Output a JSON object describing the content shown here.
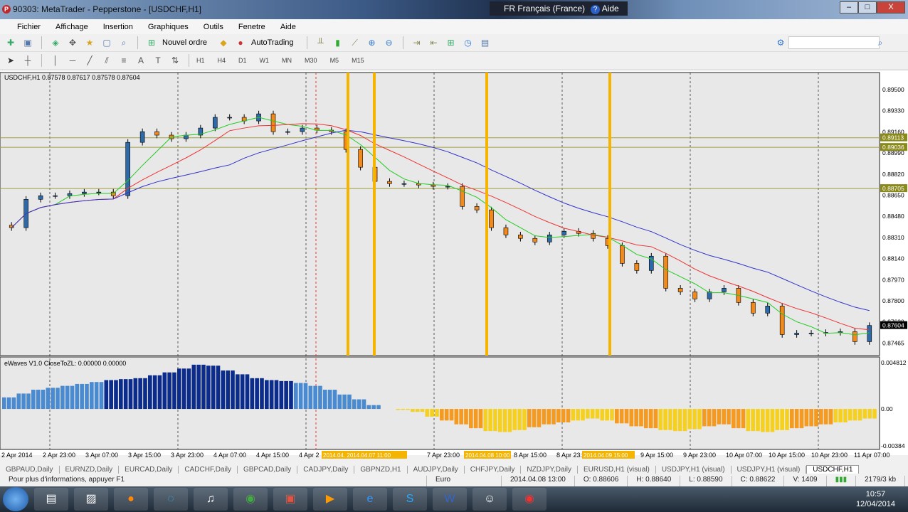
{
  "window": {
    "title": "90303: MetaTrader - Pepperstone - [USDCHF,H1]",
    "lang": "FR Français (France)",
    "help": "Aide"
  },
  "menu": [
    "Fichier",
    "Affichage",
    "Insertion",
    "Graphiques",
    "Outils",
    "Fenetre",
    "Aide"
  ],
  "toolbar": {
    "new_order": "Nouvel ordre",
    "autotrading": "AutoTrading",
    "timeframes": [
      "H1",
      "H4",
      "D1",
      "W1",
      "MN",
      "M30",
      "M5",
      "M15"
    ]
  },
  "chart": {
    "header": "USDCHF,H1  0.87578 0.87617 0.87578 0.87604",
    "indicator_header": "eWaves V1.0 CloseToZL: 0.00000 0.00000",
    "price_ticks": [
      "0.89500",
      "0.89330",
      "0.89160",
      "0.88990",
      "0.88820",
      "0.88650",
      "0.88480",
      "0.88310",
      "0.88140",
      "0.87970",
      "0.87800",
      "0.87630",
      "0.87465"
    ],
    "price_labels": [
      {
        "text": "0.89113",
        "color": "#8a8a1a"
      },
      {
        "text": "0.89036",
        "color": "#8a8a1a"
      },
      {
        "text": "0.88705",
        "color": "#8a8a1a"
      },
      {
        "text": "0.87604",
        "color": "#000000"
      }
    ],
    "ind_ticks": [
      "0.004812",
      "0.00",
      "-0.00384"
    ],
    "time_labels": [
      "2 Apr 2014",
      "2 Apr 23:00",
      "3 Apr 07:00",
      "3 Apr 15:00",
      "3 Apr 23:00",
      "4 Apr 07:00",
      "4 Apr 15:00",
      "4 Apr 2",
      "7 Apr 23:00",
      "8 Apr 15:00",
      "8 Apr 23:",
      "9 Apr 15:00",
      "9 Apr 23:00",
      "10 Apr 07:00",
      "10 Apr 15:00",
      "10 Apr 23:00",
      "11 Apr 07:00"
    ],
    "highlight_labels": [
      "2014.04.  2014.04.07 11:00",
      "2014.04.08 10:00",
      "2014.04.09 15:00"
    ]
  },
  "chart_data": {
    "type": "candlestick",
    "symbol": "USDCHF",
    "timeframe": "H1",
    "ylim": [
      0.87465,
      0.895
    ],
    "closes": [
      0.8839,
      0.88618,
      0.88647,
      0.88647,
      0.88664,
      0.88676,
      0.88676,
      0.88647,
      0.89076,
      0.89162,
      0.89134,
      0.89105,
      0.89134,
      0.89191,
      0.89277,
      0.89277,
      0.89248,
      0.89305,
      0.89162,
      0.89162,
      0.89191,
      0.89174,
      0.89162,
      0.89019,
      0.88876,
      0.88762,
      0.88744,
      0.88744,
      0.88733,
      0.88722,
      0.88722,
      0.88561,
      0.88533,
      0.8839,
      0.88332,
      0.88304,
      0.88275,
      0.88332,
      0.88361,
      0.88344,
      0.88304,
      0.88246,
      0.88103,
      0.88046,
      0.88161,
      0.87903,
      0.87874,
      0.87817,
      0.87874,
      0.87903,
      0.87789,
      0.87703,
      0.8776,
      0.87531,
      0.87542,
      0.87542,
      0.87548,
      0.87554,
      0.87474,
      0.87604
    ],
    "hlines": [
      0.89113,
      0.89036,
      0.88705
    ],
    "indicator": {
      "name": "eWaves V1.0 CloseToZL",
      "ylim": [
        -0.00384,
        0.004812
      ],
      "values": [
        1.2,
        1.6,
        2.0,
        2.2,
        2.4,
        2.6,
        2.8,
        3.0,
        3.1,
        3.2,
        3.5,
        3.8,
        4.2,
        4.6,
        4.5,
        4.0,
        3.6,
        3.2,
        3.0,
        2.9,
        2.7,
        2.4,
        2.0,
        1.5,
        1.0,
        0.4,
        0,
        -0.1,
        -0.3,
        -0.8,
        -1.2,
        -1.6,
        -2.0,
        -2.3,
        -2.4,
        -2.2,
        -1.9,
        -1.6,
        -1.4,
        -1.2,
        -1.0,
        -1.2,
        -1.5,
        -1.8,
        -2.0,
        -2.2,
        -2.3,
        -2.1,
        -1.8,
        -1.6,
        -2.0,
        -2.3,
        -2.4,
        -2.2,
        -2.0,
        -1.8,
        -1.6,
        -1.4,
        -1.2,
        -1.0
      ]
    }
  },
  "tabs": [
    "GBPAUD,Daily",
    "EURNZD,Daily",
    "EURCAD,Daily",
    "CADCHF,Daily",
    "GBPCAD,Daily",
    "CADJPY,Daily",
    "GBPNZD,H1",
    "AUDJPY,Daily",
    "CHFJPY,Daily",
    "NZDJPY,Daily",
    "EURUSD,H1 (visual)",
    "USDJPY,H1 (visual)",
    "USDJPY,H1 (visual)",
    "USDCHF,H1"
  ],
  "status": {
    "help": "Pour plus d'informations, appuyer F1",
    "profile": "Euro",
    "time": "2014.04.08 13:00",
    "open": "O: 0.88606",
    "high": "H: 0.88640",
    "low": "L: 0.88590",
    "close": "C: 0.88622",
    "volume": "V: 1409",
    "traffic": "2179/3 kb"
  },
  "clock": {
    "time": "10:57",
    "date": "12/04/2014"
  }
}
